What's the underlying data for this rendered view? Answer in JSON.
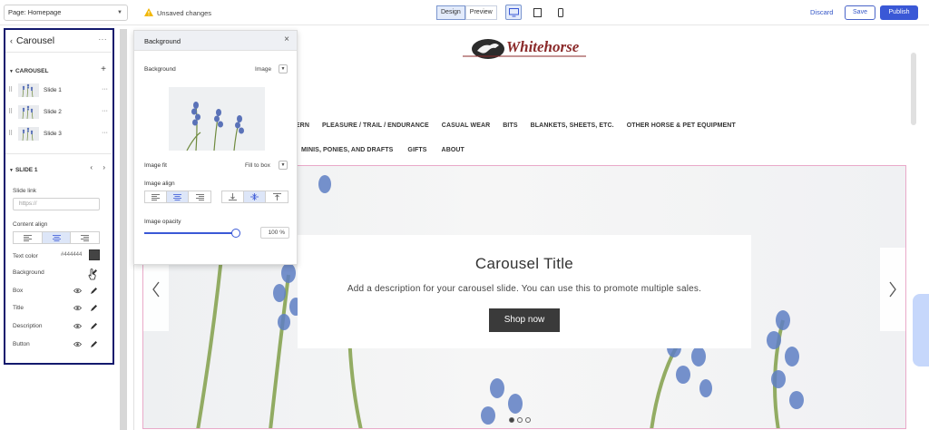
{
  "topbar": {
    "page_select": "Page: Homepage",
    "unsaved": "Unsaved changes",
    "modes": [
      "Design",
      "Preview"
    ],
    "discard": "Discard",
    "save": "Save",
    "publish": "Publish"
  },
  "left_panel": {
    "title": "Carousel",
    "carousel_section": "CAROUSEL",
    "slides": [
      "Slide 1",
      "Slide 2",
      "Slide 3"
    ],
    "slide_section": "SLIDE 1",
    "slide_link_label": "Slide link",
    "slide_link_placeholder": "https://",
    "content_align_label": "Content align",
    "text_color_label": "Text color",
    "text_color_value": "#444444",
    "rows": [
      "Background",
      "Box",
      "Title",
      "Description",
      "Button"
    ]
  },
  "popover": {
    "title": "Background",
    "background_label": "Background",
    "background_value": "Image",
    "image_fit_label": "Image fit",
    "image_fit_value": "Fill to box",
    "image_align_label": "Image align",
    "image_opacity_label": "Image opacity",
    "image_opacity_value": "100 %",
    "image_opacity": 100
  },
  "site": {
    "logo_text": "Whitehorse",
    "nav_row1": [
      "ESTERN",
      "PLEASURE / TRAIL / ENDURANCE",
      "CASUAL WEAR",
      "BITS",
      "BLANKETS, SHEETS, ETC.",
      "OTHER HORSE & PET EQUIPMENT"
    ],
    "nav_row2": [
      "MINIS, PONIES, AND DRAFTS",
      "GIFTS",
      "ABOUT"
    ],
    "hero_title": "Carousel Title",
    "hero_description": "Add a description for your carousel slide. You can use this to promote multiple sales.",
    "hero_button": "Shop now"
  },
  "colors": {
    "accent": "#3a58d6",
    "panel_border": "#13196d",
    "text_color_swatch": "#444444"
  }
}
